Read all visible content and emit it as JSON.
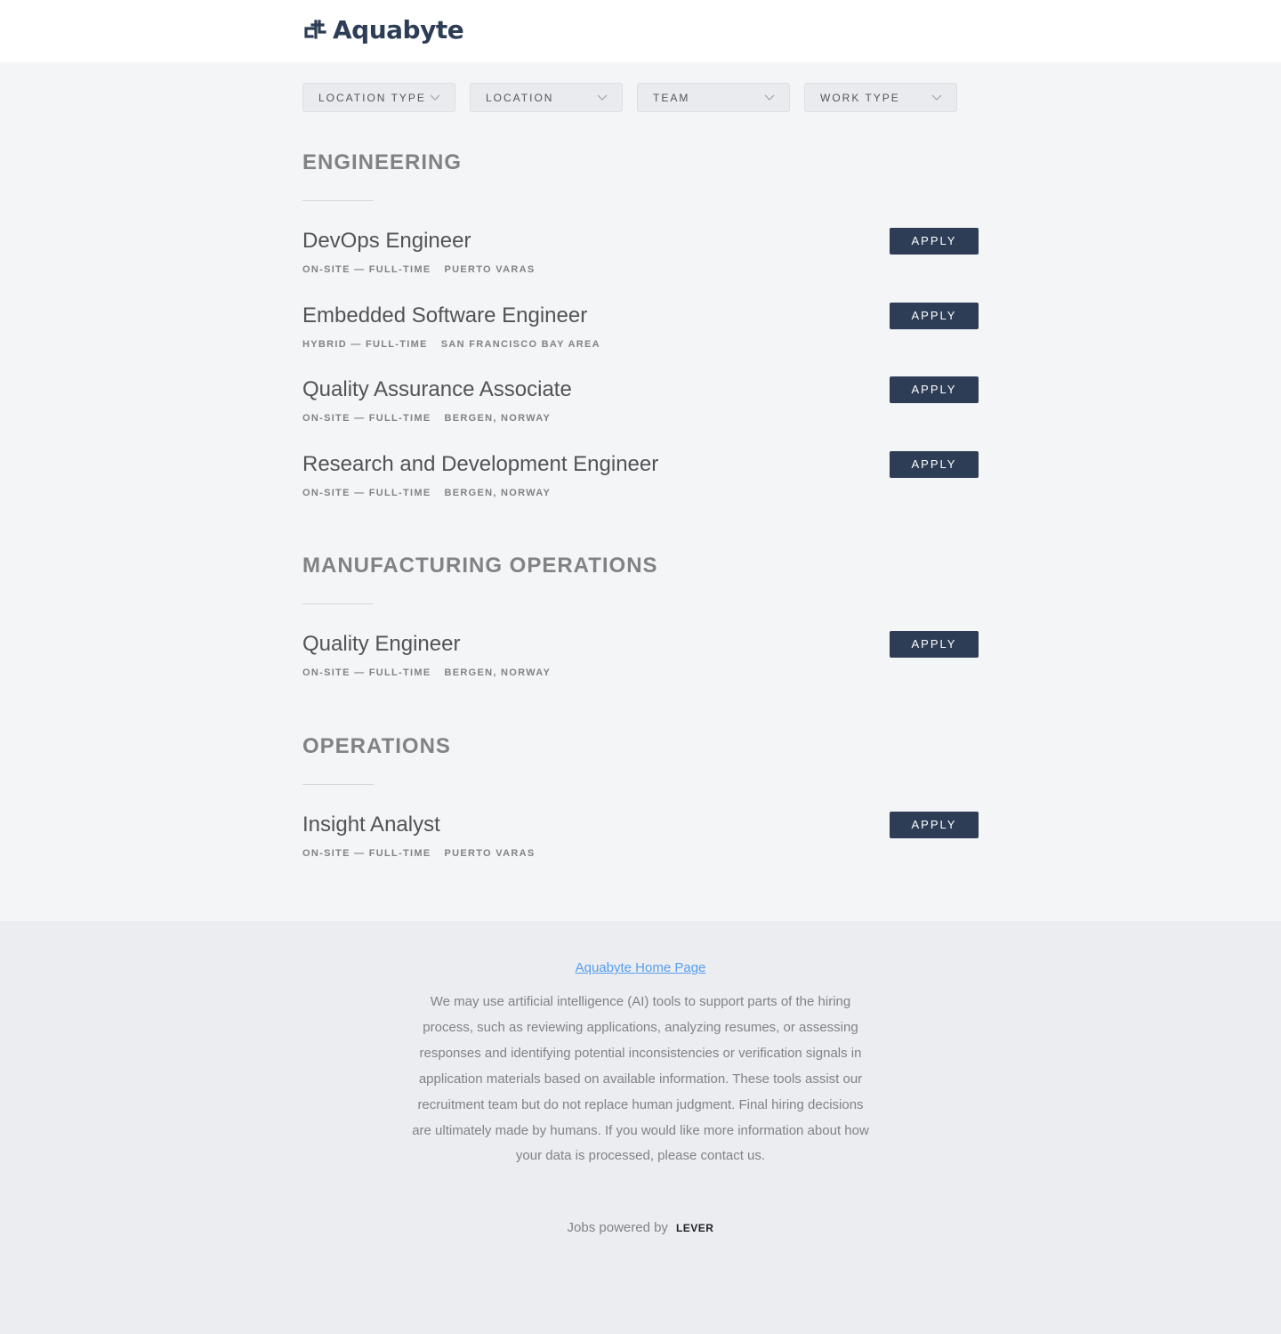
{
  "brand": {
    "name": "Aquabyte",
    "color": "#2d3d56"
  },
  "filters": [
    {
      "label": "LOCATION TYPE"
    },
    {
      "label": "LOCATION"
    },
    {
      "label": "TEAM"
    },
    {
      "label": "WORK TYPE"
    }
  ],
  "groups": [
    {
      "title": "ENGINEERING",
      "postings": [
        {
          "title": "DevOps Engineer",
          "commitment": "ON-SITE — FULL-TIME",
          "location": "PUERTO VARAS",
          "apply": "APPLY"
        },
        {
          "title": "Embedded Software Engineer",
          "commitment": "HYBRID — FULL-TIME",
          "location": "SAN FRANCISCO BAY AREA",
          "apply": "APPLY"
        },
        {
          "title": "Quality Assurance Associate",
          "commitment": "ON-SITE — FULL-TIME",
          "location": "BERGEN, NORWAY",
          "apply": "APPLY"
        },
        {
          "title": "Research and Development Engineer",
          "commitment": "ON-SITE — FULL-TIME",
          "location": "BERGEN, NORWAY",
          "apply": "APPLY"
        }
      ]
    },
    {
      "title": "MANUFACTURING OPERATIONS",
      "postings": [
        {
          "title": "Quality Engineer",
          "commitment": "ON-SITE — FULL-TIME",
          "location": "BERGEN, NORWAY",
          "apply": "APPLY"
        }
      ]
    },
    {
      "title": "OPERATIONS",
      "postings": [
        {
          "title": "Insight Analyst",
          "commitment": "ON-SITE — FULL-TIME",
          "location": "PUERTO VARAS",
          "apply": "APPLY"
        }
      ]
    }
  ],
  "footer": {
    "home_link": "Aquabyte Home Page",
    "disclaimer": "We may use artificial intelligence (AI) tools to support parts of the hiring process, such as reviewing applications, analyzing resumes, or assessing responses and identifying potential inconsistencies or verification signals in application materials based on available information. These tools assist our recruitment team but do not replace human judgment. Final hiring decisions are ultimately made by humans. If you would like more information about how your data is processed, please contact us.",
    "powered_by": "Jobs powered by",
    "lever": "LEVER"
  },
  "colors": {
    "button": "#2d3d56",
    "link": "#579eee",
    "page_bg": "#f4f5f6",
    "footer_bg": "#ebedf0"
  }
}
